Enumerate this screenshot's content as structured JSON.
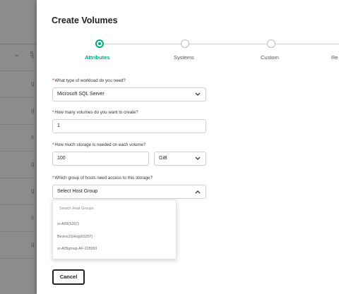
{
  "background": {
    "column_prefix": "S",
    "rows": [
      "s",
      "g",
      "g",
      "s",
      "g",
      "g",
      "s",
      "g"
    ]
  },
  "modal": {
    "title": "Create Volumes",
    "steps": [
      {
        "label": "Attributes",
        "active": true
      },
      {
        "label": "Systems",
        "active": false
      },
      {
        "label": "Custom",
        "active": false
      },
      {
        "label": "Re",
        "active": false
      }
    ],
    "questions": {
      "workload": {
        "label": "What type of workload do you need?",
        "value": "Microsoft SQL Server"
      },
      "volume_count": {
        "label": "How many volumes do you want to create?",
        "value": "1"
      },
      "storage": {
        "label": "How much storage is needed on each volume?",
        "value": "100",
        "unit": "GiB"
      },
      "host_group": {
        "label": "Which group of hosts need access to this storage?",
        "placeholder": "Select Host Group"
      }
    },
    "host_group_dropdown": {
      "search_placeholder": "Search Host Groups",
      "options": [
        "sr-A09(S207)",
        "Bevins2GHsg(6S207)",
        "sr-A05group-AF-Z28993"
      ]
    },
    "cancel_label": "Cancel"
  },
  "colors": {
    "accent": "#01a982",
    "required": "#d0021b"
  }
}
